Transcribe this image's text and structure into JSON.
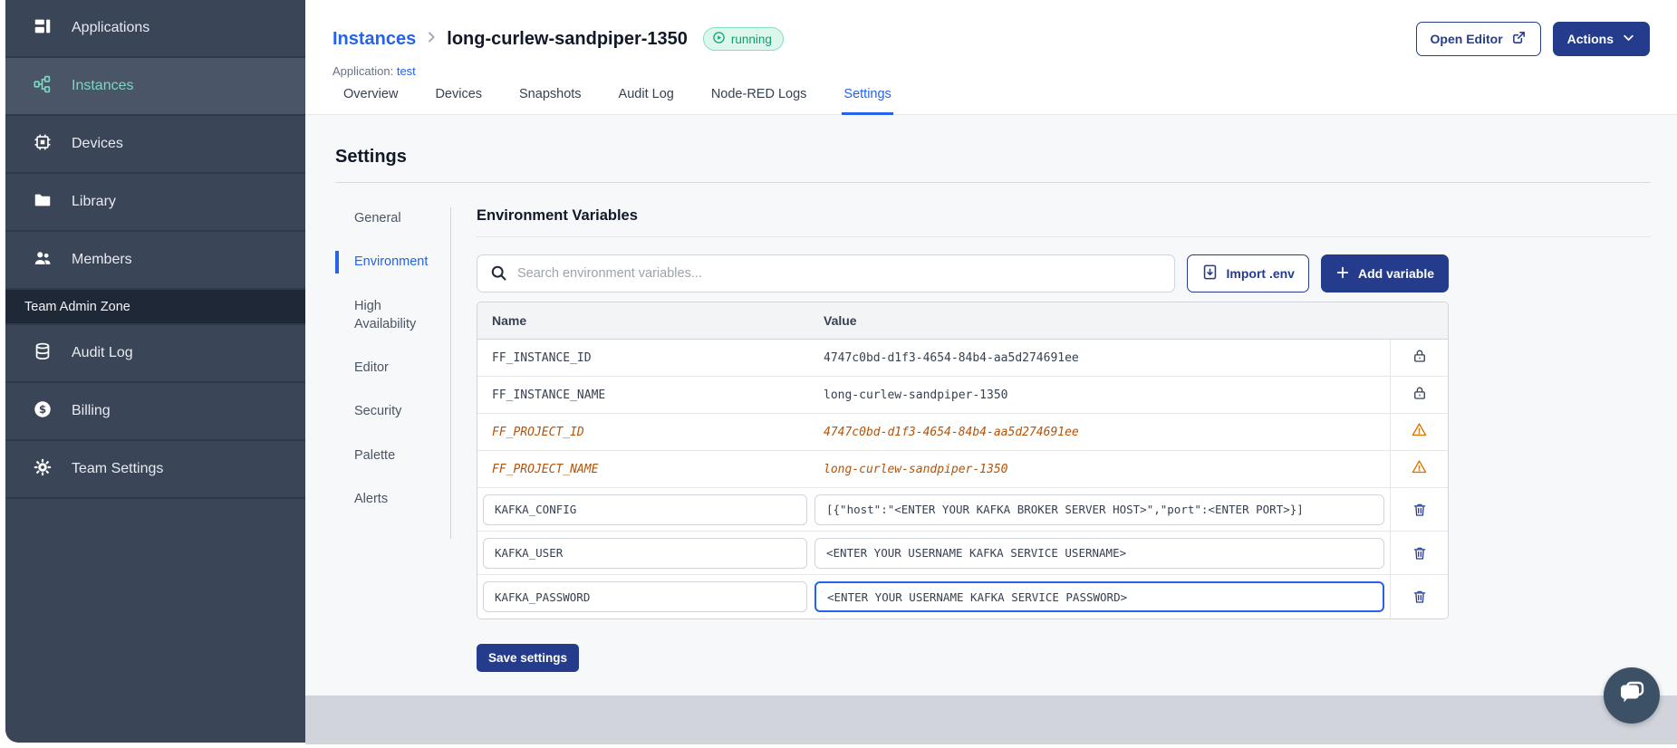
{
  "sidebar": {
    "items": [
      {
        "label": "Applications",
        "icon": "applications-icon",
        "active": false
      },
      {
        "label": "Instances",
        "icon": "instances-icon",
        "active": true
      },
      {
        "label": "Devices",
        "icon": "devices-icon",
        "active": false
      },
      {
        "label": "Library",
        "icon": "library-icon",
        "active": false
      },
      {
        "label": "Members",
        "icon": "members-icon",
        "active": false
      }
    ],
    "section_label": "Team Admin Zone",
    "admin_items": [
      {
        "label": "Audit Log",
        "icon": "audit-log-icon"
      },
      {
        "label": "Billing",
        "icon": "billing-icon"
      },
      {
        "label": "Team Settings",
        "icon": "team-settings-icon"
      }
    ]
  },
  "header": {
    "breadcrumb_root": "Instances",
    "instance_name": "long-curlew-sandpiper-1350",
    "status": "running",
    "application_label": "Application:",
    "application_name": "test",
    "open_editor_label": "Open Editor",
    "actions_label": "Actions"
  },
  "tabs": [
    {
      "label": "Overview"
    },
    {
      "label": "Devices"
    },
    {
      "label": "Snapshots"
    },
    {
      "label": "Audit Log"
    },
    {
      "label": "Node-RED Logs"
    },
    {
      "label": "Settings",
      "active": true
    }
  ],
  "settings": {
    "title": "Settings",
    "subnav": [
      {
        "label": "General"
      },
      {
        "label": "Environment",
        "active": true
      },
      {
        "label": "High Availability"
      },
      {
        "label": "Editor"
      },
      {
        "label": "Security"
      },
      {
        "label": "Palette"
      },
      {
        "label": "Alerts"
      }
    ],
    "env": {
      "title": "Environment Variables",
      "search_placeholder": "Search environment variables...",
      "import_label": "Import .env",
      "add_label": "Add variable",
      "columns": {
        "name": "Name",
        "value": "Value"
      },
      "rows": [
        {
          "name": "FF_INSTANCE_ID",
          "value": "4747c0bd-d1f3-4654-84b4-aa5d274691ee",
          "type": "locked"
        },
        {
          "name": "FF_INSTANCE_NAME",
          "value": "long-curlew-sandpiper-1350",
          "type": "locked"
        },
        {
          "name": "FF_PROJECT_ID",
          "value": "4747c0bd-d1f3-4654-84b4-aa5d274691ee",
          "type": "deprecated"
        },
        {
          "name": "FF_PROJECT_NAME",
          "value": "long-curlew-sandpiper-1350",
          "type": "deprecated"
        },
        {
          "name": "KAFKA_CONFIG",
          "value": "[{\"host\":\"<ENTER YOUR KAFKA BROKER SERVER HOST>\",\"port\":<ENTER PORT>}]",
          "type": "editable"
        },
        {
          "name": "KAFKA_USER",
          "value": "<ENTER YOUR USERNAME KAFKA SERVICE USERNAME>",
          "type": "editable"
        },
        {
          "name": "KAFKA_PASSWORD",
          "value": "<ENTER YOUR USERNAME KAFKA SERVICE PASSWORD>",
          "type": "editable",
          "focused": true
        }
      ],
      "save_label": "Save settings"
    }
  },
  "colors": {
    "sidebar_bg": "#3A4557",
    "sidebar_active_bg": "#4A5568",
    "sidebar_active_text": "#7FD6C2",
    "primary_button": "#253C8D",
    "link_blue": "#2563EB",
    "running_text": "#0E9F6E",
    "running_bg": "#DEF7EC",
    "deprecated_orange": "#B45309",
    "warning_orange": "#D97706",
    "content_bg": "#F7F8FA",
    "footer_band": "#D1D5DB",
    "chat_bubble_bg": "#3D5166"
  }
}
